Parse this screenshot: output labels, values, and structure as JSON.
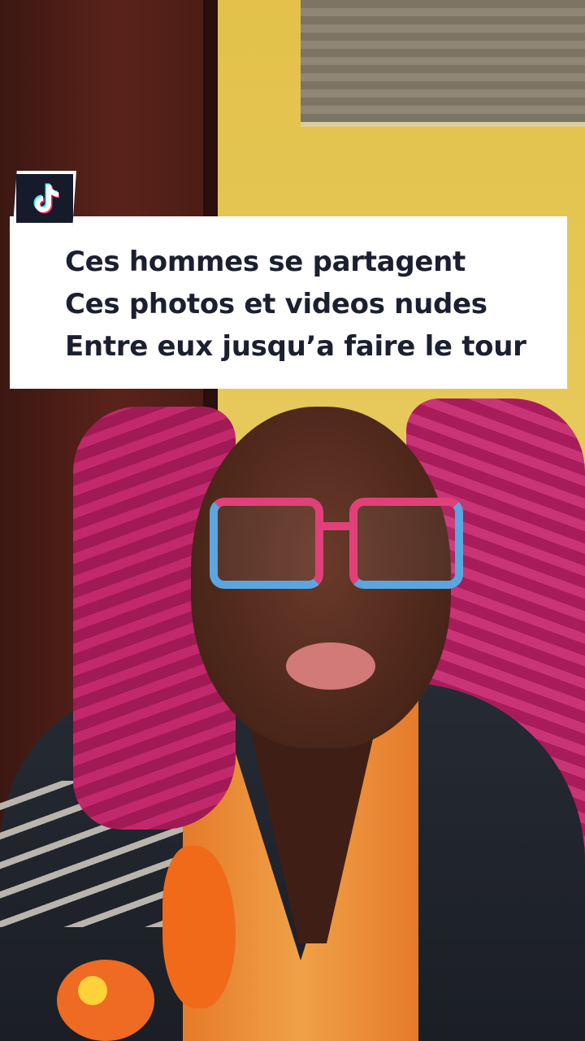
{
  "overlay": {
    "logo_icon": "tiktok-note-icon",
    "caption_lines": [
      "Ces hommes se partagent",
      "Ces photos et videos nudes",
      "Entre eux jusqu’a faire le tour"
    ]
  },
  "colors": {
    "caption_background": "#ffffff",
    "caption_text": "#1b2030",
    "logo_background": "#151b2a"
  }
}
